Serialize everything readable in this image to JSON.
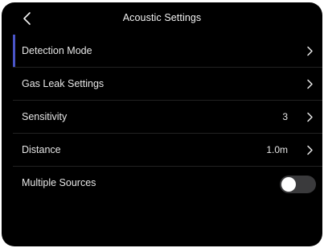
{
  "header": {
    "title": "Acoustic Settings",
    "back_icon": "chevron-left-icon"
  },
  "menu": {
    "items": [
      {
        "label": "Detection Mode",
        "value": "",
        "type": "nav",
        "active": true
      },
      {
        "label": "Gas Leak Settings",
        "value": "",
        "type": "nav",
        "active": false
      },
      {
        "label": "Sensitivity",
        "value": "3",
        "type": "nav",
        "active": false
      },
      {
        "label": "Distance",
        "value": "1.0m",
        "type": "nav",
        "active": false
      },
      {
        "label": "Multiple Sources",
        "type": "toggle",
        "on": false
      }
    ]
  },
  "colors": {
    "background": "#000000",
    "accent": "#4a55c8",
    "text": "#e6e6e6",
    "toggle_off": "#3a3a3c",
    "divider": "#222222"
  }
}
